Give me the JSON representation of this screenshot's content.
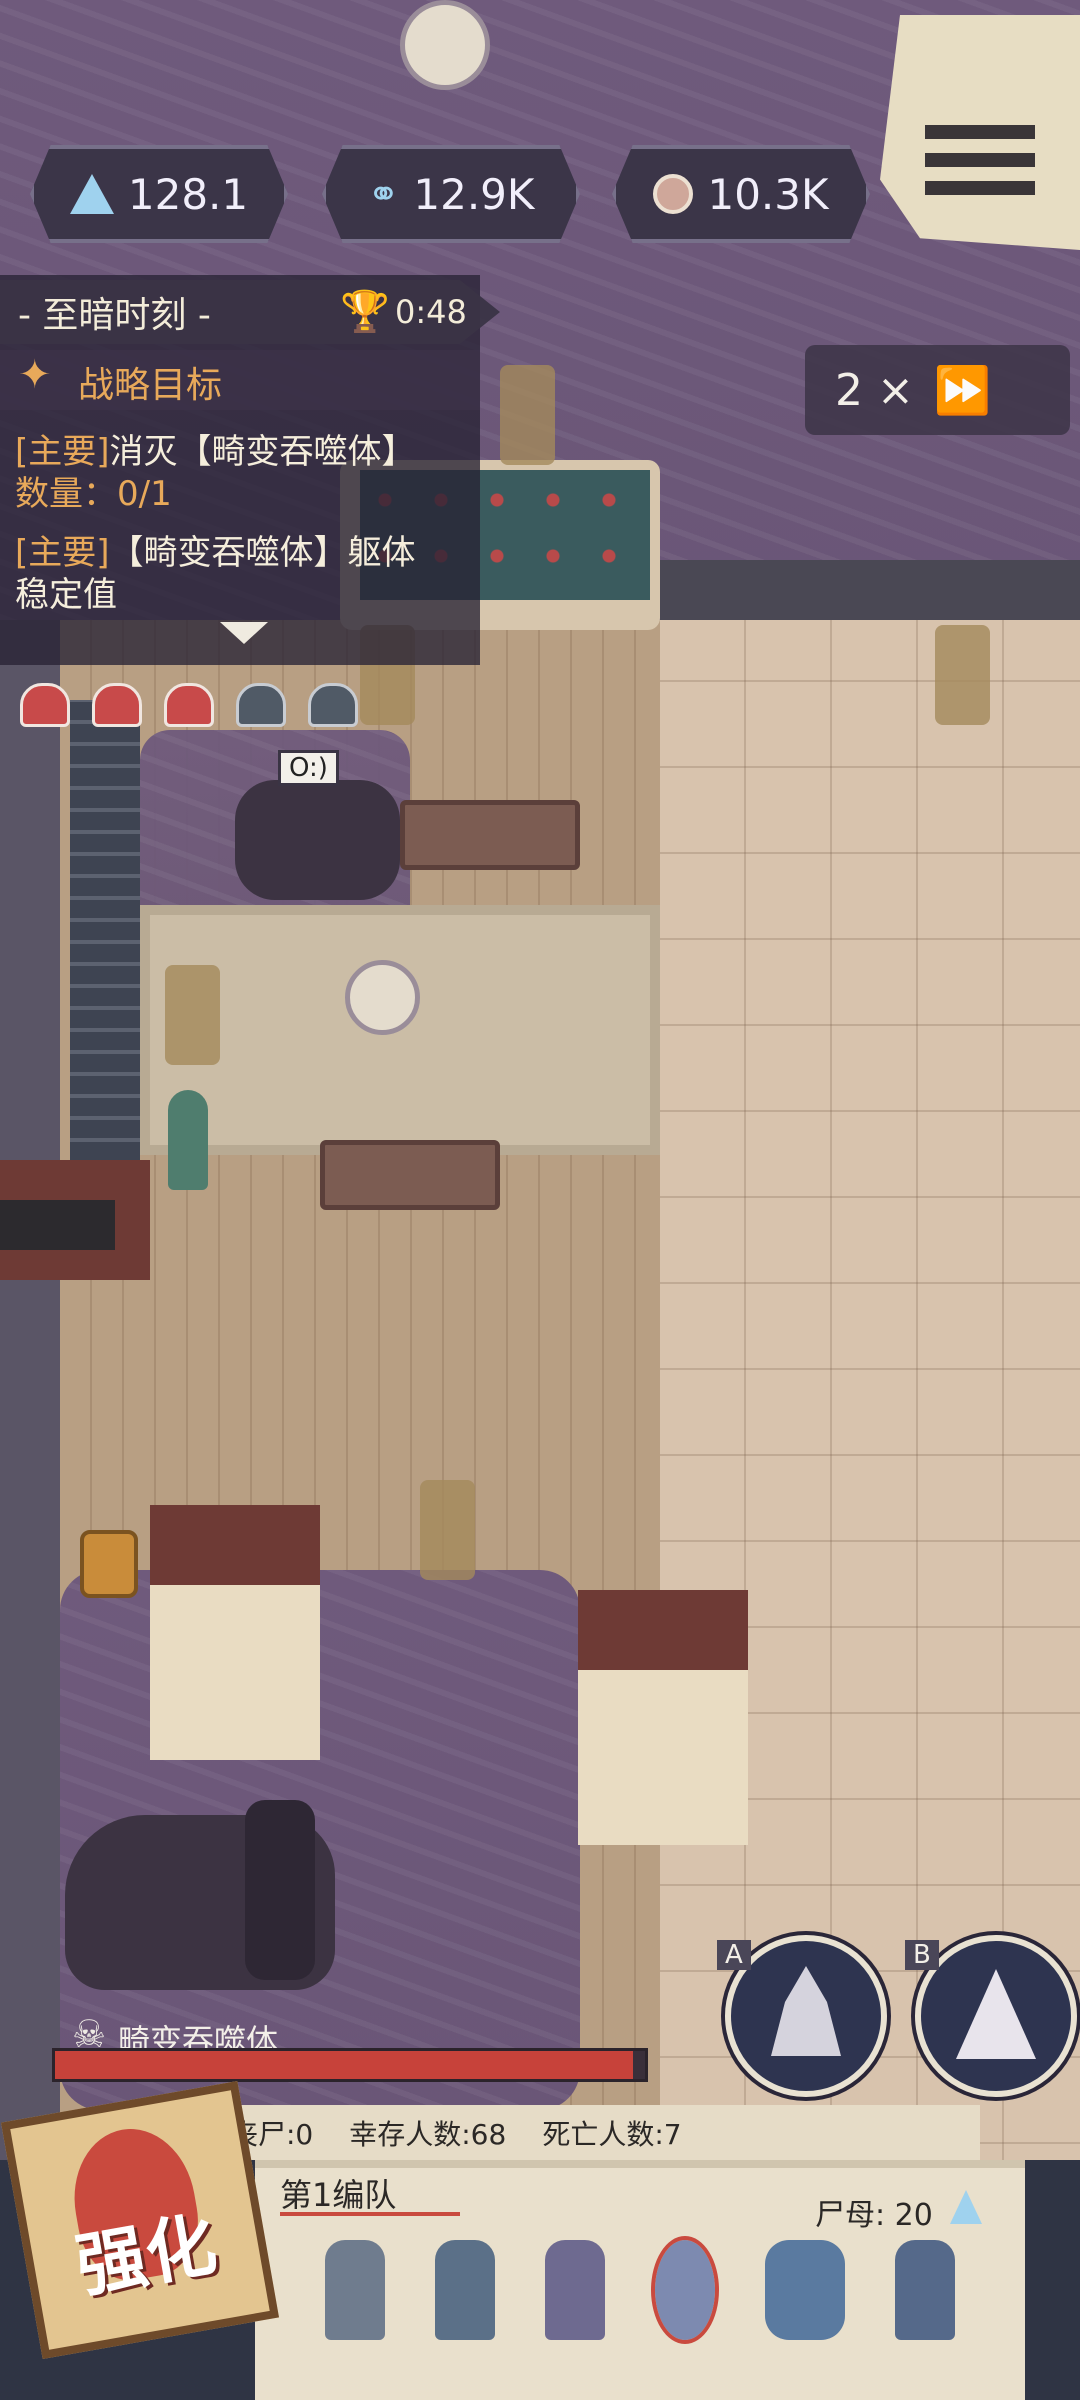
{
  "resources": [
    {
      "icon": "crystal-icon",
      "value": "128.1"
    },
    {
      "icon": "dna-icon",
      "value": "12.9K"
    },
    {
      "icon": "brain-icon",
      "value": "10.3K"
    }
  ],
  "mission": {
    "title": "- 至暗时刻 -",
    "timer": "0:48",
    "objectives_header": "战略目标",
    "objectives": [
      {
        "tag": "[主要]",
        "text": "消灭【畸变吞噬体】",
        "sub": "数量：0/1"
      },
      {
        "tag": "[主要]",
        "text": "【畸变吞噬体】躯体",
        "sub": "稳定值"
      }
    ]
  },
  "speed": {
    "label": "2 ×"
  },
  "speech_bubble": "O:)",
  "boss": {
    "name": "畸变吞噬体",
    "hp_fraction": 0.98
  },
  "stats": {
    "zombies": "丧尸:0",
    "survivors": "幸存人数:68",
    "dead": "死亡人数:7"
  },
  "squad": {
    "name": "第1编队",
    "mother_label": "尸母: 20"
  },
  "skills": [
    {
      "key": "A",
      "icon": "fire-skill-icon"
    },
    {
      "key": "B",
      "icon": "spike-skill-icon"
    }
  ],
  "upgrade_button": "强化",
  "helmets": {
    "active": 3,
    "total": 5
  },
  "colors": {
    "accent": "#e8a95a",
    "boss_hp": "#c7423a",
    "hud_bg": "#3b3548"
  }
}
